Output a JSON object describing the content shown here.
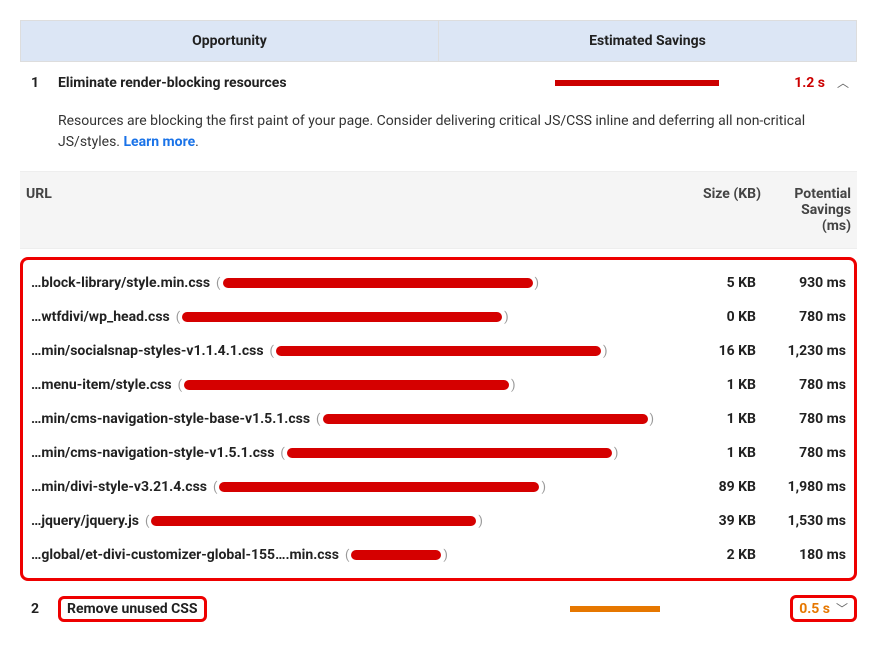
{
  "header": {
    "opportunity": "Opportunity",
    "savings": "Estimated Savings"
  },
  "opps": [
    {
      "num": "1",
      "title": "Eliminate render-blocking resources",
      "time": "1.2 s",
      "barPct": 82,
      "desc_a": "Resources are blocking the first paint of your page. Consider delivering critical JS/CSS inline and deferring all non-critical JS/styles. ",
      "learn": "Learn more",
      "desc_b": "."
    },
    {
      "num": "2",
      "title": "Remove unused CSS",
      "time": "0.5 s",
      "barPct": 45
    }
  ],
  "table": {
    "cols": {
      "url": "URL",
      "size": "Size (KB)",
      "savings": "Potential Savings (ms)"
    },
    "rows": [
      {
        "path": "…block-library/style.min.css",
        "rw": 310,
        "size": "5 KB",
        "savings": "930 ms"
      },
      {
        "path": "…wtfdivi/wp_head.css",
        "rw": 320,
        "size": "0 KB",
        "savings": "780 ms"
      },
      {
        "path": "…min/socialsnap-styles-v1.1.4.1.css",
        "rw": 325,
        "size": "16 KB",
        "savings": "1,230 ms"
      },
      {
        "path": "…menu-item/style.css",
        "rw": 325,
        "size": "1 KB",
        "savings": "780 ms"
      },
      {
        "path": "…min/cms-navigation-style-base-v1.5.1.css",
        "rw": 325,
        "size": "1 KB",
        "savings": "780 ms"
      },
      {
        "path": "…min/cms-navigation-style-v1.5.1.css",
        "rw": 325,
        "size": "1 KB",
        "savings": "780 ms"
      },
      {
        "path": "…min/divi-style-v3.21.4.css",
        "rw": 320,
        "size": "89 KB",
        "savings": "1,980 ms"
      },
      {
        "path": "…jquery/jquery.js",
        "rw": 325,
        "size": "39 KB",
        "savings": "1,530 ms"
      },
      {
        "path": "…global/et-divi-customizer-global-155….min.css",
        "rw": 90,
        "size": "2 KB",
        "savings": "180 ms"
      }
    ]
  }
}
